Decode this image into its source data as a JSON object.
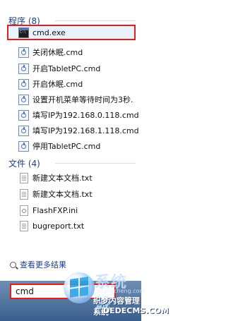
{
  "programs": {
    "header": "程序 (8)",
    "items": [
      {
        "label": "cmd.exe",
        "icon": "cmd-icon"
      },
      {
        "label": "关闭休眠.cmd",
        "icon": "batch-file-icon"
      },
      {
        "label": "开启TabletPC.cmd",
        "icon": "batch-file-icon"
      },
      {
        "label": "开启休眠.cmd",
        "icon": "batch-file-icon"
      },
      {
        "label": "设置开机菜单等待时间为3秒.",
        "icon": "batch-file-icon"
      },
      {
        "label": "填写IP为192.168.0.118.cmd",
        "icon": "batch-file-icon"
      },
      {
        "label": "填写IP为192.168.1.118.cmd",
        "icon": "batch-file-icon"
      },
      {
        "label": "停用TabletPC.cmd",
        "icon": "batch-file-icon"
      }
    ]
  },
  "files": {
    "header": "文件 (4)",
    "items": [
      {
        "label": "新建文本文档.txt",
        "icon": "text-file-icon"
      },
      {
        "label": "新建文本文档.txt",
        "icon": "text-file-icon"
      },
      {
        "label": "FlashFXP.ini",
        "icon": "ini-file-icon"
      },
      {
        "label": "bugreport.txt",
        "icon": "text-file-icon"
      }
    ]
  },
  "see_more": "查看更多结果",
  "search": {
    "value": "cmd"
  },
  "logo": {
    "main": "系统城",
    "sub": "xitongcheng.com",
    "line1": "织梦内容管理系统",
    "line2": "DEDECMS.COM"
  },
  "colors": {
    "accent": "#1e3f8a",
    "highlight": "#e02020",
    "taskbar": "#3a5f8c"
  }
}
